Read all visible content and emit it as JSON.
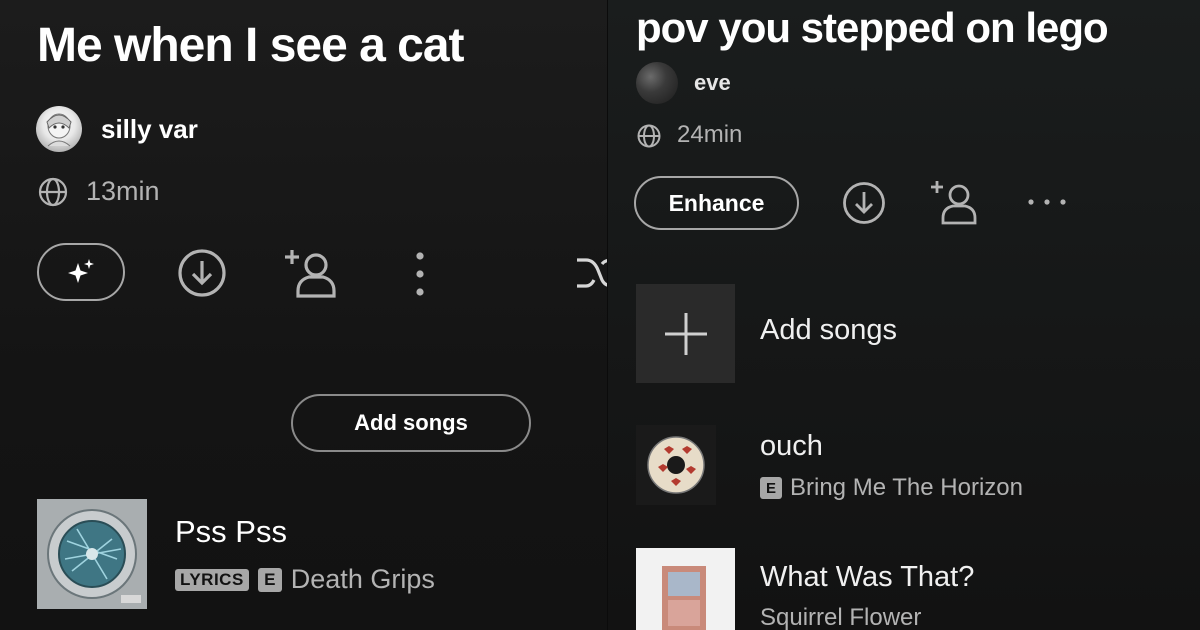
{
  "left": {
    "playlist_title": "Me when I see a cat",
    "owner_name": "silly var",
    "duration": "13min",
    "actions": {
      "ai_icon": "sparkle-icon",
      "download_icon": "download-icon",
      "add_user_icon": "add-user-icon",
      "more_icon": "more-vertical-icon",
      "shuffle_icon": "shuffle-icon"
    },
    "add_songs_label": "Add songs",
    "tracks": [
      {
        "title": "Pss Pss",
        "lyrics_badge": "LYRICS",
        "explicit_badge": "E",
        "artist": "Death Grips"
      }
    ]
  },
  "right": {
    "playlist_title": "pov you stepped on lego",
    "owner_name": "eve",
    "duration": "24min",
    "enhance_label": "Enhance",
    "add_songs_label": "Add songs",
    "tracks": [
      {
        "title": "ouch",
        "explicit_badge": "E",
        "artist": "Bring Me The Horizon"
      },
      {
        "title": "What Was That?",
        "artist": "Squirrel Flower"
      }
    ]
  },
  "colors": {
    "background": "#121212",
    "primary_text": "#ffffff",
    "secondary_text": "#b3b3b3",
    "outline": "#a7a7a7"
  }
}
